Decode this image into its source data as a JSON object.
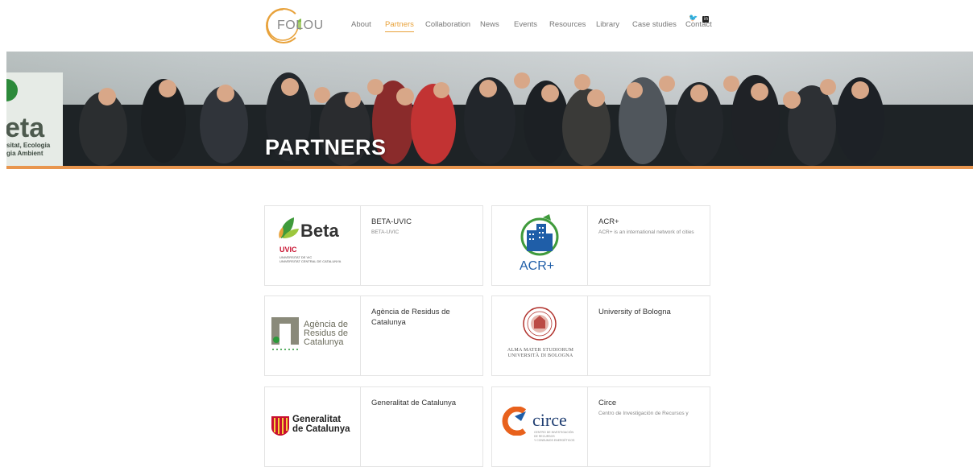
{
  "header": {
    "logo_text": "FOLOU",
    "nav": [
      "About",
      "Partners",
      "Collaboration",
      "News",
      "Events",
      "Resources",
      "Library",
      "Case studies",
      "Contact"
    ],
    "active": "Partners"
  },
  "hero": {
    "title": "PARTNERS",
    "banner_text": {
      "big": "eta",
      "line1": "sitat, Ecologia",
      "line2": "gia Ambient"
    }
  },
  "partners": [
    {
      "name": "BETA-UVIC",
      "description": "BETA-UVIC",
      "logo": {
        "brand": "Beta",
        "subbrand": "UVIC",
        "lines": [
          "UNIVERSITAT DE VIC",
          "UNIVERSITAT CENTRAL DE CATALUNYA"
        ]
      }
    },
    {
      "name": "ACR+",
      "description": "ACR+ is an international network of cities",
      "logo": {
        "brand": "ACR+"
      }
    },
    {
      "name": "Agència de Residus de Catalunya",
      "description": "",
      "logo": {
        "lines": [
          "Agència de",
          "Residus de",
          "Catalunya"
        ]
      }
    },
    {
      "name": "University of Bologna",
      "description": "",
      "logo": {
        "lines": [
          "ALMA MATER STUDIORUM",
          "UNIVERSITÀ DI BOLOGNA"
        ]
      }
    },
    {
      "name": "Generalitat de Catalunya",
      "description": "",
      "logo": {
        "lines": [
          "Generalitat",
          "de Catalunya"
        ]
      }
    },
    {
      "name": "Circe",
      "description": "Centro de Investigación de Recursos y",
      "logo": {
        "brand": "circe",
        "lines": [
          "CENTRO DE INVESTIGACIÓN",
          "DE RECURSOS",
          "Y CONSUMOS ENERGÉTICOS"
        ]
      }
    }
  ],
  "colors": {
    "accent": "#e8a23b",
    "hero_bar": "#e8954e",
    "beta_green": "#3f9a3b",
    "acr_blue": "#1f5ea8",
    "circe_orange": "#e8611c",
    "bologna_red": "#b0302b",
    "gencat_red": "#c8102e"
  }
}
